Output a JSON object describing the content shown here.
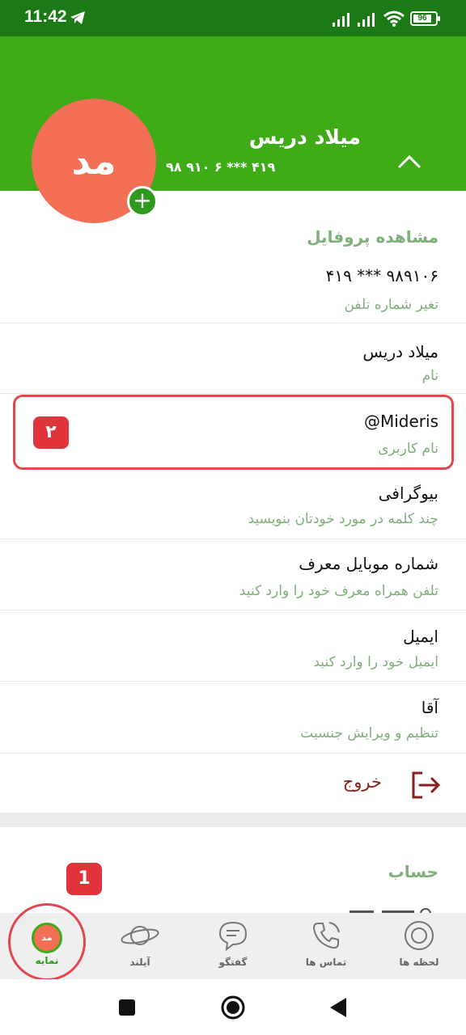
{
  "status_bar": {
    "time": "11:42",
    "battery": "96",
    "icons": [
      "telegram-icon",
      "signal-icon",
      "signal-icon",
      "wifi-icon",
      "battery-icon"
    ]
  },
  "header": {
    "avatar_initials": "مد",
    "name": "میلاد دریس",
    "phone": "۹۸ ۹۱۰ ۶ *** ۴۱۹",
    "colors": {
      "bar": "#3eab17",
      "status": "#1c7a16",
      "avatar": "#f36f55"
    }
  },
  "profile": {
    "section_title": "مشاهده پروفایل",
    "rows": [
      {
        "value": "۹۸۹۱۰۶ *** ۴۱۹",
        "hint": "تغیر شماره تلفن"
      },
      {
        "value": "میلاد دریس",
        "hint": "نام"
      },
      {
        "value": "@Mideris",
        "hint": "نام کاربری"
      },
      {
        "value": "بیوگرافی",
        "hint": "چند کلمه در مورد خودتان بنویسید"
      },
      {
        "value": "شماره موبایل معرف",
        "hint": "تلفن همراه معرف خود را وارد کنید"
      },
      {
        "value": "ایمیل",
        "hint": "ایمیل خود را وارد کنید"
      },
      {
        "value": "آقا",
        "hint": "تنظیم و ویرایش جنسیت"
      }
    ],
    "logout": "خروج"
  },
  "account": {
    "title": "حساب"
  },
  "badges": {
    "one": "1",
    "two": "۲"
  },
  "bottom_nav": [
    {
      "label": "لحظه ها",
      "icon": "moments-icon"
    },
    {
      "label": "تماس ها",
      "icon": "calls-icon"
    },
    {
      "label": "گفتگو",
      "icon": "chat-icon"
    },
    {
      "label": "آیلند",
      "icon": "planet-icon"
    },
    {
      "label": "نمایه",
      "icon": "profile-avatar-icon",
      "avatar_initials": "مد",
      "active": true
    }
  ]
}
